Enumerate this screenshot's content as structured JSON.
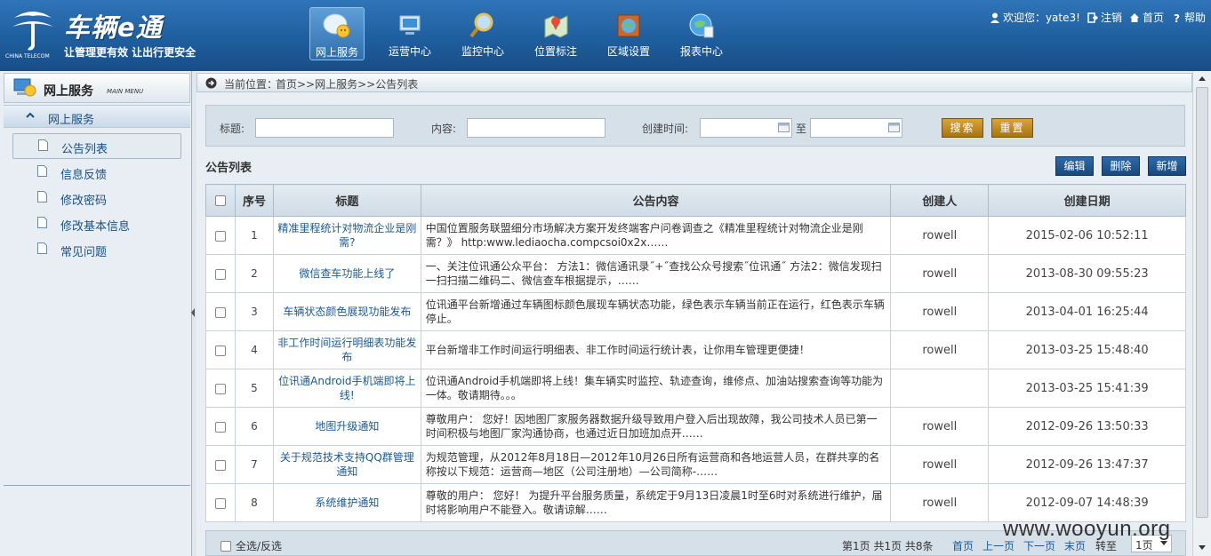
{
  "header": {
    "brand_title": "车辆e通",
    "brand_slogan": "让管理更有效 让出行更安全",
    "carrier_logo_text": "中国电信",
    "carrier_logo_sub": "CHINA TELECOM",
    "nav": [
      {
        "label": "网上服务",
        "icon": "chat-bubble-icon",
        "active": true
      },
      {
        "label": "运营中心",
        "icon": "monitor-icon",
        "active": false
      },
      {
        "label": "监控中心",
        "icon": "magnifier-icon",
        "active": false
      },
      {
        "label": "位置标注",
        "icon": "map-pin-icon",
        "active": false
      },
      {
        "label": "区域设置",
        "icon": "globe-frame-icon",
        "active": false
      },
      {
        "label": "报表中心",
        "icon": "globe-chart-icon",
        "active": false
      }
    ],
    "top_links": {
      "welcome": "欢迎您：yate3!",
      "logout": "注销",
      "home": "首页",
      "help": "帮助"
    }
  },
  "sidebar": {
    "title": "网上服务",
    "subtitle": "MAIN MENU",
    "section": "网上服务",
    "items": [
      {
        "label": "公告列表",
        "active": true
      },
      {
        "label": "信息反馈",
        "active": false
      },
      {
        "label": "修改密码",
        "active": false
      },
      {
        "label": "修改基本信息",
        "active": false
      },
      {
        "label": "常见问题",
        "active": false
      }
    ]
  },
  "breadcrumb": {
    "label": "当前位置：",
    "path": "首页>>网上服务>>公告列表"
  },
  "search": {
    "title_label": "标题:",
    "title_value": "",
    "content_label": "内容:",
    "content_value": "",
    "date_label": "创建时间:",
    "date_from": "",
    "to_label": "至",
    "date_to": "",
    "search_button": "搜索",
    "reset_button": "重置"
  },
  "list": {
    "title": "公告列表",
    "edit_button": "编辑",
    "delete_button": "删除",
    "add_button": "新增",
    "columns": [
      "序号",
      "标题",
      "公告内容",
      "创建人",
      "创建日期"
    ],
    "rows": [
      {
        "no": "1",
        "title": "精准里程统计对物流企业是刚需?",
        "content": "中国位置服务联盟细分市场解决方案开发终端客户问卷调查之《精准里程统计对物流企业是刚需？》 http:www.lediaocha.compcsoi0x2x……",
        "creator": "rowell",
        "date": "2015-02-06 10:52:11"
      },
      {
        "no": "2",
        "title": "微信查车功能上线了",
        "content": "一、关注位讯通公众平台： 方法1：微信通讯录˝+˝查找公众号搜索˝位讯通˝ 方法2：微信发现扫一扫扫描二维码二、微信查车根据提示，……",
        "creator": "rowell",
        "date": "2013-08-30 09:55:23"
      },
      {
        "no": "3",
        "title": "车辆状态颜色展现功能发布",
        "content": "位讯通平台新增通过车辆图标颜色展现车辆状态功能，绿色表示车辆当前正在运行，红色表示车辆停止。",
        "creator": "rowell",
        "date": "2013-04-01 16:25:44"
      },
      {
        "no": "4",
        "title": "非工作时间运行明细表功能发布",
        "content": "平台新增非工作时间运行明细表、非工作时间运行统计表，让你用车管理更便捷！",
        "creator": "rowell",
        "date": "2013-03-25 15:48:40"
      },
      {
        "no": "5",
        "title": "位讯通Android手机端即将上线!",
        "content": "位讯通Android手机端即将上线！集车辆实时监控、轨迹查询，维修点、加油站搜索查询等功能为一体。敬请期待。。。",
        "creator": "",
        "date": "2013-03-25 15:41:39"
      },
      {
        "no": "6",
        "title": "地图升级通知",
        "content": "尊敬用户： 您好！因地图厂家服务器数据升级导致用户登入后出现故障，我公司技术人员已第一时间积极与地图厂家沟通协商，也通过近日加班加点开……",
        "creator": "rowell",
        "date": "2012-09-26 13:50:33"
      },
      {
        "no": "7",
        "title": "关于规范技术支持QQ群管理通知",
        "content": "为规范管理，从2012年8月18日—2012年10月26日所有运营商和各地运营人员，在群共享的名称按以下规范：运营商—地区（公司注册地）—公司简称-……",
        "creator": "rowell",
        "date": "2012-09-26 13:47:37"
      },
      {
        "no": "8",
        "title": "系统维护通知",
        "content": "尊敬的用户： 您好！ 为提升平台服务质量，系统定于9月13日凌晨1时至6时对系统进行维护，届时将影响用户不能登入。敬请谅解……",
        "creator": "rowell",
        "date": "2012-09-07 14:48:39"
      }
    ]
  },
  "pager": {
    "select_all": "全选/反选",
    "info": "第1页 共1页 共8条",
    "first": "首页",
    "prev": "上一页",
    "next": "下一页",
    "last": "末页",
    "goto_label": "转至",
    "page_select": "1页"
  },
  "watermark": "www.wooyun.org",
  "colors": {
    "header_blue": "#1f5e9e",
    "link_blue": "#1a5a96",
    "gold_button": "#c28b22",
    "dark_blue_button": "#18497c"
  }
}
